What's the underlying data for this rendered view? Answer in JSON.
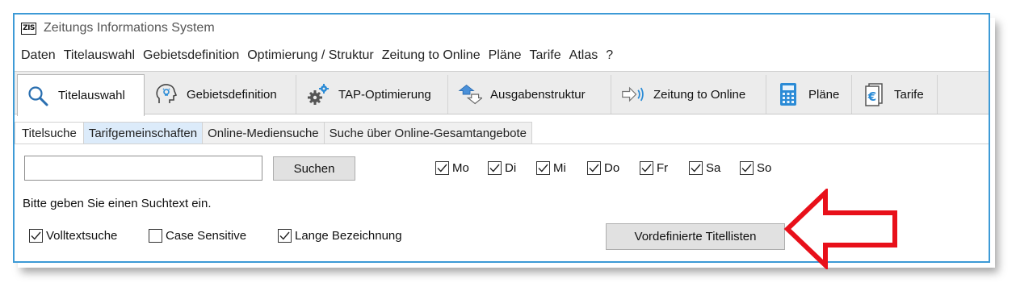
{
  "window": {
    "title": "Zeitungs Informations System",
    "logo_text": "ZIS"
  },
  "menu": [
    "Daten",
    "Titelauswahl",
    "Gebietsdefinition",
    "Optimierung / Struktur",
    "Zeitung to Online",
    "Pläne",
    "Tarife",
    "Atlas",
    "?"
  ],
  "toolbar": {
    "tabs": [
      {
        "label": "Titelauswahl",
        "icon": "magnifier-icon"
      },
      {
        "label": "Gebietsdefinition",
        "icon": "head-map-icon"
      },
      {
        "label": "TAP-Optimierung",
        "icon": "gears-icon"
      },
      {
        "label": "Ausgabenstruktur",
        "icon": "structure-arrows-icon"
      },
      {
        "label": "Zeitung to Online",
        "icon": "arrow-signal-icon"
      },
      {
        "label": "Pläne",
        "icon": "calculator-icon"
      },
      {
        "label": "Tarife",
        "icon": "euro-icon"
      }
    ]
  },
  "subtabs": [
    "Titelsuche",
    "Tarifgemeinschaften",
    "Online-Mediensuche",
    "Suche über Online-Gesamtangebote"
  ],
  "search": {
    "value": "",
    "placeholder": "",
    "button_label": "Suchen"
  },
  "days": [
    {
      "label": "Mo",
      "checked": true
    },
    {
      "label": "Di",
      "checked": true
    },
    {
      "label": "Mi",
      "checked": true
    },
    {
      "label": "Do",
      "checked": true
    },
    {
      "label": "Fr",
      "checked": true
    },
    {
      "label": "Sa",
      "checked": true
    },
    {
      "label": "So",
      "checked": true
    }
  ],
  "hint": "Bitte geben Sie einen Suchtext ein.",
  "options": [
    {
      "label": "Volltextsuche",
      "checked": true
    },
    {
      "label": "Case Sensitive",
      "checked": false
    },
    {
      "label": "Lange Bezeichnung",
      "checked": true
    }
  ],
  "predefined_button_label": "Vordefinierte Titellisten",
  "colors": {
    "window_border": "#3d9ad6",
    "arrow": "#e8101a",
    "hover_tab": "#dcebfa"
  }
}
